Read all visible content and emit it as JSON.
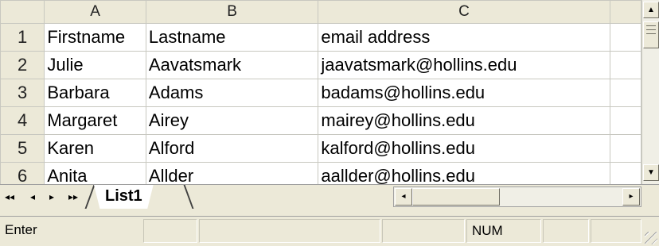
{
  "columns": [
    "A",
    "B",
    "C"
  ],
  "rows": [
    {
      "num": "1",
      "a": "Firstname",
      "b": "Lastname",
      "c": "email address"
    },
    {
      "num": "2",
      "a": "Julie",
      "b": "Aavatsmark",
      "c": "jaavatsmark@hollins.edu"
    },
    {
      "num": "3",
      "a": "Barbara",
      "b": "Adams",
      "c": "badams@hollins.edu"
    },
    {
      "num": "4",
      "a": "Margaret",
      "b": "Airey",
      "c": "mairey@hollins.edu"
    },
    {
      "num": "5",
      "a": "Karen",
      "b": "Alford",
      "c": "kalford@hollins.edu"
    },
    {
      "num": "6",
      "a": "Anita",
      "b": "Allder",
      "c": "aallder@hollins.edu"
    }
  ],
  "sheet_tab": "List1",
  "status": {
    "mode": "Enter",
    "num": "NUM"
  },
  "icons": {
    "scroll_up": "▲",
    "scroll_down": "▼",
    "first_sheet": "◂◂",
    "prev_sheet": "◂",
    "next_sheet": "▸",
    "last_sheet": "▸▸",
    "scroll_left": "◂",
    "scroll_right": "▸"
  },
  "colors": {
    "header_bg": "#ece9d8",
    "gridline": "#c8c8c0"
  }
}
